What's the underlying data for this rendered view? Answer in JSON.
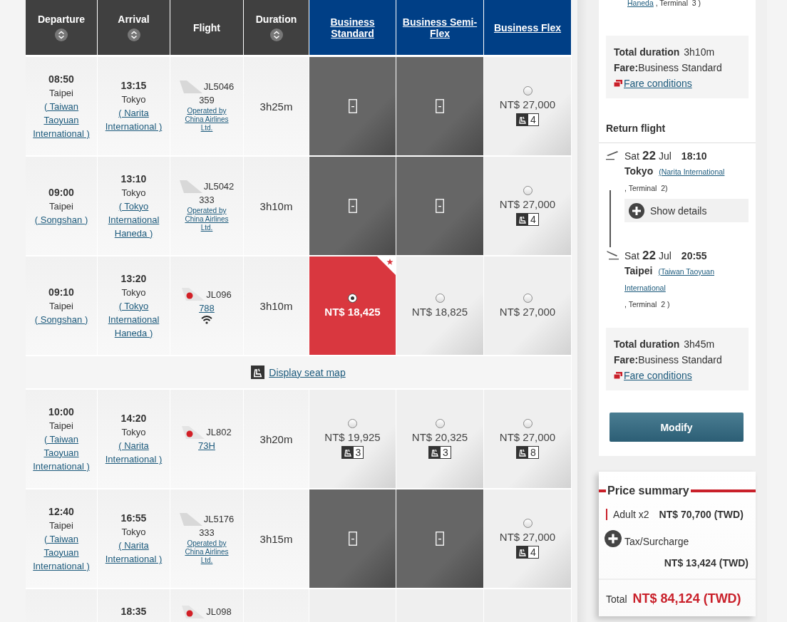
{
  "fare_table": {
    "columns": [
      {
        "label": "Departure",
        "sortable": true
      },
      {
        "label": "Arrival",
        "sortable": true
      },
      {
        "label": "Flight",
        "sortable": false
      },
      {
        "label": "Duration",
        "sortable": true
      }
    ],
    "fare_columns": [
      {
        "label": "Business Standard"
      },
      {
        "label": "Business Semi-Flex"
      },
      {
        "label": "Business Flex"
      }
    ],
    "rows": [
      {
        "kind": "flight",
        "departure": {
          "time": "08:50",
          "city": "Taipei",
          "airport": "( Taiwan Taoyuan International )"
        },
        "arrival": {
          "time": "13:15",
          "city": "Tokyo",
          "airport": "( Narita International )"
        },
        "flight": {
          "airline_logo": false,
          "number": "JL5046",
          "aircraft": "359",
          "aircraft_link": false,
          "operated_by": "Operated by China Airlines Ltd.",
          "wifi": false
        },
        "duration": "3h25m",
        "fares": [
          {
            "available": false,
            "selected": false,
            "recommended": false
          },
          {
            "available": false,
            "selected": false,
            "recommended": false
          },
          {
            "available": true,
            "selected": false,
            "recommended": false,
            "price": "NT$ 27,000",
            "seats": "4"
          }
        ]
      },
      {
        "kind": "flight",
        "departure": {
          "time": "09:00",
          "city": "Taipei",
          "airport": "( Songshan )"
        },
        "arrival": {
          "time": "13:10",
          "city": "Tokyo",
          "airport": "( Tokyo International Haneda )"
        },
        "flight": {
          "airline_logo": false,
          "number": "JL5042",
          "aircraft": "333",
          "aircraft_link": false,
          "operated_by": "Operated by China Airlines Ltd.",
          "wifi": false
        },
        "duration": "3h10m",
        "fares": [
          {
            "available": false,
            "selected": false,
            "recommended": false
          },
          {
            "available": false,
            "selected": false,
            "recommended": false
          },
          {
            "available": true,
            "selected": false,
            "recommended": false,
            "price": "NT$ 27,000",
            "seats": "4"
          }
        ]
      },
      {
        "kind": "flight",
        "departure": {
          "time": "09:10",
          "city": "Taipei",
          "airport": "( Songshan )"
        },
        "arrival": {
          "time": "13:20",
          "city": "Tokyo",
          "airport": "( Tokyo International Haneda )"
        },
        "flight": {
          "airline_logo": true,
          "number": "JL096",
          "aircraft": "788",
          "aircraft_link": true,
          "wifi": true
        },
        "duration": "3h10m",
        "fares": [
          {
            "available": true,
            "selected": true,
            "recommended": true,
            "price": "NT$ 18,425"
          },
          {
            "available": true,
            "selected": false,
            "recommended": false,
            "price": "NT$ 18,825"
          },
          {
            "available": true,
            "selected": false,
            "recommended": false,
            "price": "NT$ 27,000"
          }
        ]
      },
      {
        "kind": "seatmap",
        "label": "Display seat map"
      },
      {
        "kind": "flight",
        "departure": {
          "time": "10:00",
          "city": "Taipei",
          "airport": "( Taiwan Taoyuan International )"
        },
        "arrival": {
          "time": "14:20",
          "city": "Tokyo",
          "airport": "( Narita International )"
        },
        "flight": {
          "airline_logo": true,
          "number": "JL802",
          "aircraft": "73H",
          "aircraft_link": true,
          "wifi": false
        },
        "duration": "3h20m",
        "fares": [
          {
            "available": true,
            "selected": false,
            "recommended": false,
            "price": "NT$ 19,925",
            "seats": "3"
          },
          {
            "available": true,
            "selected": false,
            "recommended": false,
            "price": "NT$ 20,325",
            "seats": "3"
          },
          {
            "available": true,
            "selected": false,
            "recommended": false,
            "price": "NT$ 27,000",
            "seats": "8"
          }
        ]
      },
      {
        "kind": "flight",
        "departure": {
          "time": "12:40",
          "city": "Taipei",
          "airport": "( Taiwan Taoyuan International )"
        },
        "arrival": {
          "time": "16:55",
          "city": "Tokyo",
          "airport": "( Narita International )"
        },
        "flight": {
          "airline_logo": false,
          "number": "JL5176",
          "aircraft": "333",
          "aircraft_link": false,
          "operated_by": "Operated by China Airlines Ltd.",
          "wifi": false
        },
        "duration": "3h15m",
        "fares": [
          {
            "available": false,
            "selected": false,
            "recommended": false
          },
          {
            "available": false,
            "selected": false,
            "recommended": false
          },
          {
            "available": true,
            "selected": false,
            "recommended": false,
            "price": "NT$ 27,000",
            "seats": "4"
          }
        ]
      },
      {
        "kind": "flight",
        "arrival": {
          "time": "18:35"
        },
        "flight": {
          "airline_logo": true,
          "number": "JL098"
        },
        "fares": [
          {
            "available": true,
            "selected": false,
            "recommended": false
          },
          {
            "available": true,
            "selected": false,
            "recommended": false
          },
          {
            "available": true,
            "selected": false,
            "recommended": false
          }
        ]
      }
    ]
  },
  "sidebar": {
    "outbound_tail": {
      "airport": "Haneda",
      "rest": " , Terminal  3 )"
    },
    "outbound_summary": {
      "duration_label": "Total duration",
      "duration": "3h10m",
      "fare_label": "Fare:",
      "fare": "Business Standard",
      "conditions": "Fare conditions"
    },
    "return_heading": "Return flight",
    "return_segments": [
      {
        "kind": "departure",
        "day": "Sat",
        "date": "22",
        "month": "Jul",
        "time": "18:10",
        "city": "Tokyo",
        "airport": [
          "(Narita International"
        ],
        "terminal": ", Terminal  2)"
      },
      {
        "kind": "arrival",
        "day": "Sat",
        "date": "22",
        "month": "Jul",
        "time": "20:55",
        "city": "Taipei",
        "airport": [
          "(Taiwan Taoyuan",
          "International"
        ],
        "terminal": ", Terminal  2 )"
      }
    ],
    "details_button": "Show details",
    "return_summary": {
      "duration_label": "Total duration",
      "duration": "3h45m",
      "fare_label": "Fare:",
      "fare": "Business Standard",
      "conditions": "Fare conditions"
    },
    "modify_button": "Modify",
    "price_summary": {
      "title": "Price summary",
      "lines": [
        {
          "kind": "fare",
          "label": "Adult x2",
          "amount": "NT$ 70,700 (TWD)"
        },
        {
          "kind": "tax",
          "label": "Tax/Surcharge",
          "amount": "NT$ 13,424 (TWD)"
        }
      ],
      "total_label": "Total",
      "total": "NT$ 84,124 (TWD)"
    }
  }
}
